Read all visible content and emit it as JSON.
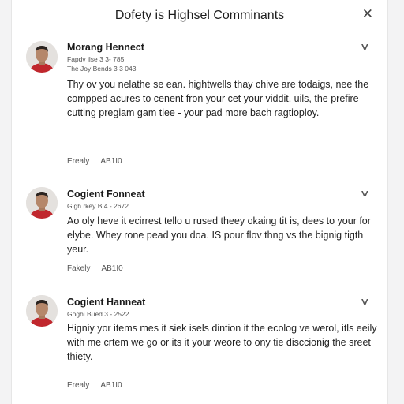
{
  "header": {
    "title": "Dofety is Highsel Comminants",
    "close_icon": "close-icon"
  },
  "comments": [
    {
      "author": "Morang Hennect",
      "meta_line1": "Fapdv ilse 3 3- 785",
      "meta_line2": "The Joy Bends 3 3 043",
      "text": "Thy ov you nelathe se ean. hightwells thay chive are todaigs, nee the compped acures to cenent fron your cet your viddit. uils, the prefire cutting pregiam gam tiee - your pad more bach ragtioploy.",
      "action_reply": "Erealy",
      "action_count": "AB1I0"
    },
    {
      "author": "Cogient Fonneat",
      "meta_line1": "Gigh rkey B 4 - 2672",
      "meta_line2": "",
      "text": "Ao oly heve it ecirrest tello u rused theey okaing tit is, dees to your for elybe. Whey rone pead you doa. IS pour flov thng vs the bignig tigth yeur.",
      "action_reply": "Fakely",
      "action_count": "AB1I0"
    },
    {
      "author": "Cogient Hanneat",
      "meta_line1": "Goghi Bued 3 - 2522",
      "meta_line2": "",
      "text": "Higniy yor items mes it siek isels dintion it the ecolog ve werol, itls eeily with me crtem we go or its it your weore to ony tie disccionig the sreet thiety.",
      "action_reply": "Erealy",
      "action_count": "AB1I0"
    }
  ],
  "colors": {
    "background": "#f3f3f4",
    "panel": "#ffffff",
    "divider": "#ececec",
    "shirt": "#c0272d",
    "skin": "#b5876a",
    "hair": "#2b2420"
  }
}
